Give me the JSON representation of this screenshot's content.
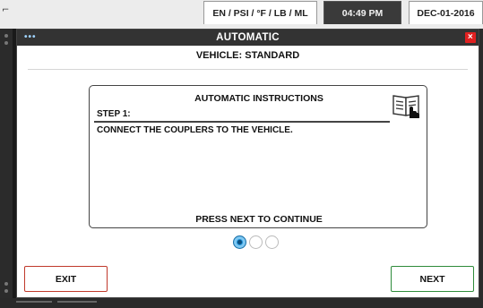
{
  "status_bar": {
    "units": "EN / PSI / °F / LB / ML",
    "time": "04:49 PM",
    "date": "DEC-01-2016"
  },
  "window": {
    "title": "AUTOMATIC",
    "close_glyph": "×",
    "menu_glyph": "•••"
  },
  "vehicle_label": "VEHICLE: STANDARD",
  "instructions": {
    "title": "AUTOMATIC INSTRUCTIONS",
    "step_label": "STEP 1:",
    "step_text": "CONNECT THE COUPLERS TO THE VEHICLE.",
    "footer": "PRESS NEXT TO CONTINUE",
    "icon": "manual-book-hand-icon"
  },
  "pager": {
    "total": 3,
    "current": 1,
    "active_color": "#1e90d6"
  },
  "buttons": {
    "exit": "EXIT",
    "next": "NEXT",
    "exit_border_color": "#c0392b",
    "next_border_color": "#2e8b3a"
  }
}
